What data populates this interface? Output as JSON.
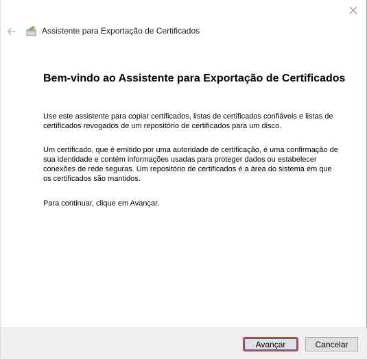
{
  "window": {
    "title": "Assistente para Exportação de Certificados"
  },
  "content": {
    "heading": "Bem-vindo ao Assistente para Exportação de Certificados",
    "paragraph1": "Use este assistente para copiar certificados, listas de certificados confiáveis e listas de certificados revogados de um repositório de certificados para um disco.",
    "paragraph2": "Um certificado, que é emitido por uma autoridade de certificação, é uma confirmação de sua identidade e contém informações usadas para proteger dados ou estabelecer conexões de rede seguras. Um repositório de certificados é a área do sistema em que os certificados são mantidos.",
    "paragraph3": "Para continuar, clique em Avançar."
  },
  "buttons": {
    "next": "Avançar",
    "cancel": "Cancelar"
  },
  "icons": {
    "close": "close-icon",
    "back": "back-arrow-icon",
    "wizard": "certificate-wizard-icon"
  }
}
